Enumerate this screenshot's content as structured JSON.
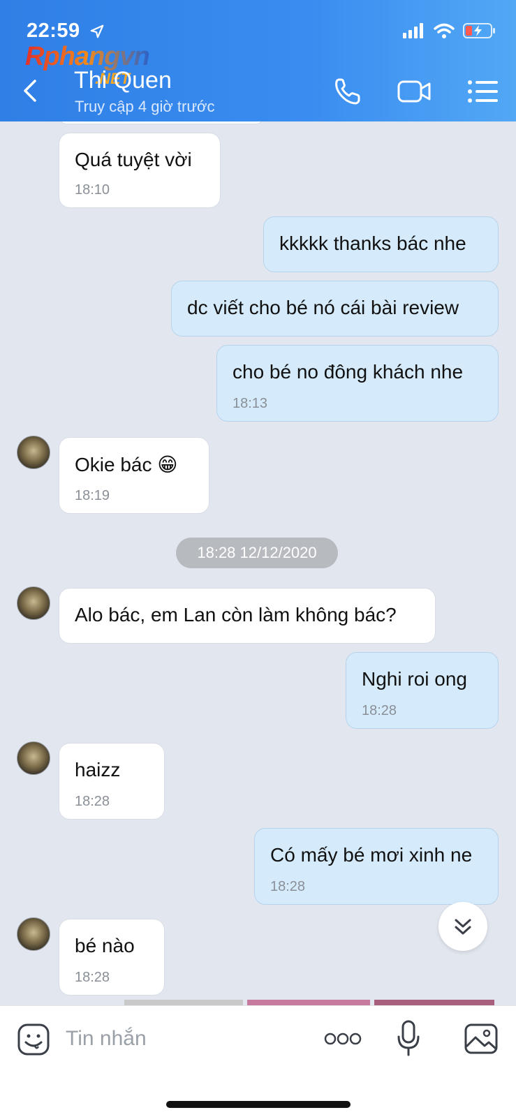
{
  "status_bar": {
    "time": "22:59"
  },
  "watermark": {
    "brand": "Rphangvn",
    "suffix": ".NET"
  },
  "header": {
    "contact_name": "Thi Quen",
    "contact_status": "Truy cập 4 giờ trước",
    "back_icon": "chevron-left-icon",
    "call_icon": "phone-icon",
    "video_icon": "video-camera-icon",
    "menu_icon": "list-menu-icon"
  },
  "messages": [
    {
      "side": "in",
      "text": "Quá tuyệt vời",
      "time": "18:10"
    },
    {
      "side": "out",
      "text": "kkkkk thanks bác nhe",
      "time": ""
    },
    {
      "side": "out",
      "text": "dc viết cho bé nó cái bài review",
      "time": ""
    },
    {
      "side": "out",
      "text": "cho bé no đông khách nhe",
      "time": "18:13"
    },
    {
      "side": "in",
      "text": "Okie bác 😁",
      "time": "18:19"
    },
    {
      "side": "in",
      "text": "Alo bác, em Lan còn làm không bác?",
      "time": ""
    },
    {
      "side": "out",
      "text": "Nghi roi ong",
      "time": "18:28"
    },
    {
      "side": "in",
      "text": "haizz",
      "time": "18:28"
    },
    {
      "side": "out",
      "text": "Có mấy bé mơi xinh ne",
      "time": "18:28"
    },
    {
      "side": "in",
      "text": "bé nào",
      "time": "18:28"
    }
  ],
  "date_separator": "18:28 12/12/2020",
  "input_bar": {
    "placeholder": "Tin nhắn",
    "sticker_icon": "sticker-face-icon",
    "more_icon": "more-dots-icon",
    "mic_icon": "microphone-icon",
    "image_icon": "image-gallery-icon"
  },
  "colors": {
    "header": "#3a8df0",
    "outgoing_bubble": "#d5ebfb",
    "incoming_bubble": "#ffffff",
    "chat_bg": "#e2e6ee"
  }
}
